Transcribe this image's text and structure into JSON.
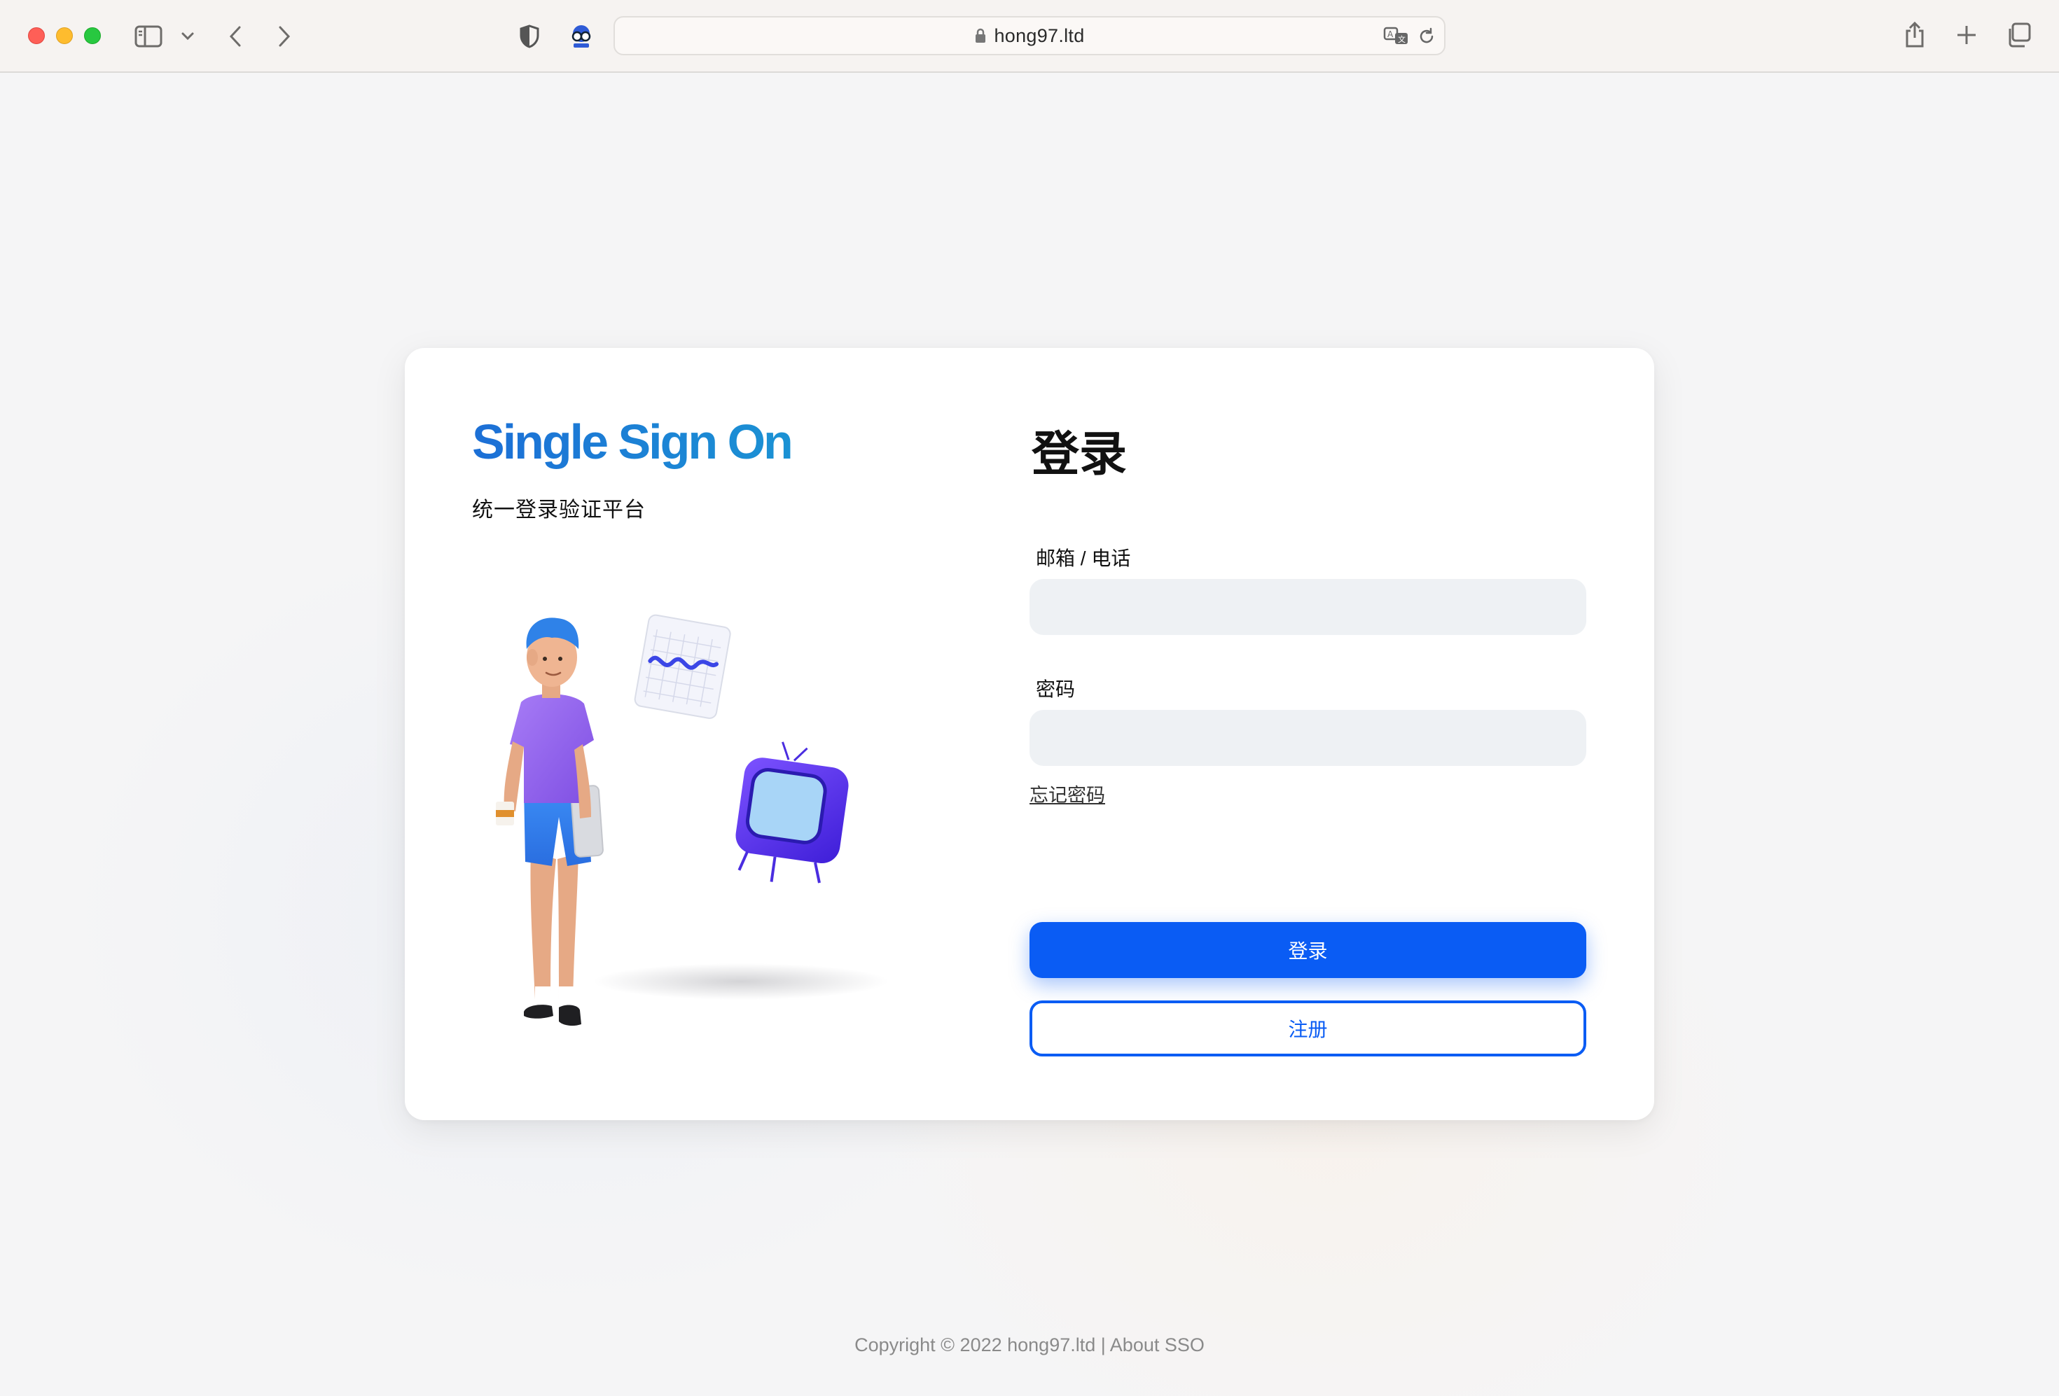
{
  "browser": {
    "url": "hong97.ltd",
    "icons": {
      "sidebar": "sidebar-icon",
      "chevron": "chevron-down-icon",
      "back": "back-arrow-icon",
      "forward": "forward-arrow-icon",
      "shield": "privacy-shield-icon",
      "extension": "extension-icon",
      "lock": "lock-icon",
      "translate": "translate-icon",
      "reload": "reload-icon",
      "share": "share-icon",
      "new_tab": "plus-icon",
      "tabs": "tab-overview-icon"
    }
  },
  "brand": {
    "title": "Single Sign On",
    "subtitle": "统一登录验证平台",
    "gradient": [
      "#1c6fd6",
      "#1b92d4"
    ]
  },
  "form": {
    "title": "登录",
    "email_label": "邮箱 / 电话",
    "email_value": "",
    "password_label": "密码",
    "password_value": "",
    "forgot_link": "忘记密码",
    "login_button": "登录",
    "register_button": "注册",
    "accent": "#0a5cf4"
  },
  "footer": {
    "copyright": "Copyright © 2022 hong97.ltd",
    "separator": "|",
    "about": "About SSO"
  }
}
